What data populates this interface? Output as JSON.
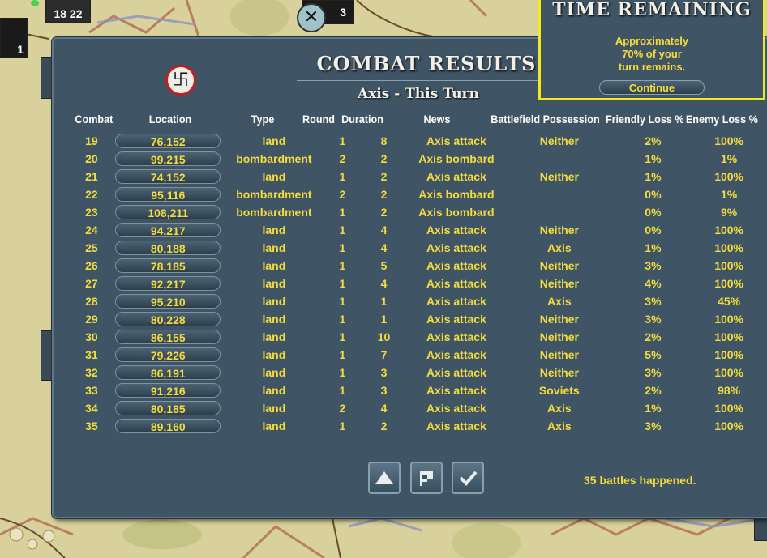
{
  "dialog": {
    "title": "COMBAT RESULTS",
    "subtitle": "Axis - This Turn",
    "emblem_icon": "swastika-emblem-icon",
    "headers": {
      "combat": "Combat",
      "location": "Location",
      "type": "Type",
      "round": "Round",
      "duration": "Duration",
      "news": "News",
      "possession": "Battlefield Possession",
      "friendly_loss": "Friendly Loss %",
      "enemy_loss": "Enemy Loss %"
    },
    "rows": [
      {
        "combat": "19",
        "location": "76,152",
        "type": "land",
        "round": "1",
        "duration": "8",
        "news": "Axis attack",
        "possession": "Neither",
        "friendly_loss": "2%",
        "enemy_loss": "100%"
      },
      {
        "combat": "20",
        "location": "99,215",
        "type": "bombardment",
        "round": "2",
        "duration": "2",
        "news": "Axis bombard",
        "possession": "",
        "friendly_loss": "1%",
        "enemy_loss": "1%"
      },
      {
        "combat": "21",
        "location": "74,152",
        "type": "land",
        "round": "1",
        "duration": "2",
        "news": "Axis attack",
        "possession": "Neither",
        "friendly_loss": "1%",
        "enemy_loss": "100%"
      },
      {
        "combat": "22",
        "location": "95,116",
        "type": "bombardment",
        "round": "2",
        "duration": "2",
        "news": "Axis bombard",
        "possession": "",
        "friendly_loss": "0%",
        "enemy_loss": "1%"
      },
      {
        "combat": "23",
        "location": "108,211",
        "type": "bombardment",
        "round": "1",
        "duration": "2",
        "news": "Axis bombard",
        "possession": "",
        "friendly_loss": "0%",
        "enemy_loss": "9%"
      },
      {
        "combat": "24",
        "location": "94,217",
        "type": "land",
        "round": "1",
        "duration": "4",
        "news": "Axis attack",
        "possession": "Neither",
        "friendly_loss": "0%",
        "enemy_loss": "100%"
      },
      {
        "combat": "25",
        "location": "80,188",
        "type": "land",
        "round": "1",
        "duration": "4",
        "news": "Axis attack",
        "possession": "Axis",
        "friendly_loss": "1%",
        "enemy_loss": "100%"
      },
      {
        "combat": "26",
        "location": "78,185",
        "type": "land",
        "round": "1",
        "duration": "5",
        "news": "Axis attack",
        "possession": "Neither",
        "friendly_loss": "3%",
        "enemy_loss": "100%"
      },
      {
        "combat": "27",
        "location": "92,217",
        "type": "land",
        "round": "1",
        "duration": "4",
        "news": "Axis attack",
        "possession": "Neither",
        "friendly_loss": "4%",
        "enemy_loss": "100%"
      },
      {
        "combat": "28",
        "location": "95,210",
        "type": "land",
        "round": "1",
        "duration": "1",
        "news": "Axis attack",
        "possession": "Axis",
        "friendly_loss": "3%",
        "enemy_loss": "45%"
      },
      {
        "combat": "29",
        "location": "80,228",
        "type": "land",
        "round": "1",
        "duration": "1",
        "news": "Axis attack",
        "possession": "Neither",
        "friendly_loss": "3%",
        "enemy_loss": "100%"
      },
      {
        "combat": "30",
        "location": "86,155",
        "type": "land",
        "round": "1",
        "duration": "10",
        "news": "Axis attack",
        "possession": "Neither",
        "friendly_loss": "2%",
        "enemy_loss": "100%"
      },
      {
        "combat": "31",
        "location": "79,226",
        "type": "land",
        "round": "1",
        "duration": "7",
        "news": "Axis attack",
        "possession": "Neither",
        "friendly_loss": "5%",
        "enemy_loss": "100%"
      },
      {
        "combat": "32",
        "location": "86,191",
        "type": "land",
        "round": "1",
        "duration": "3",
        "news": "Axis attack",
        "possession": "Neither",
        "friendly_loss": "3%",
        "enemy_loss": "100%"
      },
      {
        "combat": "33",
        "location": "91,216",
        "type": "land",
        "round": "1",
        "duration": "3",
        "news": "Axis attack",
        "possession": "Soviets",
        "friendly_loss": "2%",
        "enemy_loss": "98%"
      },
      {
        "combat": "34",
        "location": "80,185",
        "type": "land",
        "round": "2",
        "duration": "4",
        "news": "Axis attack",
        "possession": "Axis",
        "friendly_loss": "1%",
        "enemy_loss": "100%"
      },
      {
        "combat": "35",
        "location": "89,160",
        "type": "land",
        "round": "1",
        "duration": "2",
        "news": "Axis attack",
        "possession": "Axis",
        "friendly_loss": "3%",
        "enemy_loss": "100%"
      }
    ],
    "buttons": [
      {
        "name": "scroll-up-button",
        "icon": "up-triangle-icon"
      },
      {
        "name": "flag-button",
        "icon": "flag-icon"
      },
      {
        "name": "confirm-button",
        "icon": "checkmark-icon"
      }
    ],
    "summary": "35 battles happened."
  },
  "time_panel": {
    "title": "TIME REMAINING",
    "line1": "Approximately",
    "line2": "70% of your",
    "line3": "turn remains.",
    "continue_label": "Continue"
  },
  "map": {
    "counters": [
      {
        "name": "unit-counter-top-left",
        "text": "18 22"
      },
      {
        "name": "unit-counter-left",
        "text": "1"
      },
      {
        "name": "unit-counter-artillery",
        "text": "3"
      }
    ]
  },
  "colors": {
    "panel_bg": "#3f5566",
    "table_text": "#f4dc3e",
    "header_text": "#ffffff",
    "time_border": "#f2e91f",
    "map_bg": "#d9d19b"
  }
}
